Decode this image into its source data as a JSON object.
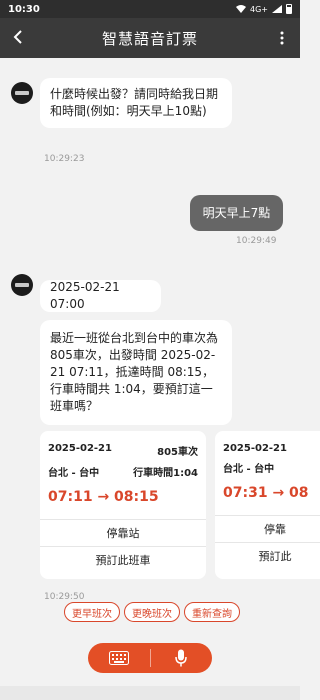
{
  "status": {
    "time": "10:30",
    "network": "4G+"
  },
  "appbar": {
    "back_icon": "arrow-left-icon",
    "title": "智慧語音訂票",
    "more_icon": "more-vert-icon"
  },
  "messages": [
    {
      "from": "bot",
      "text": "什麼時候出發？請同時給我日期和時間(例如：明天早上10點)",
      "time": "10:29:23"
    },
    {
      "from": "user",
      "text": "明天早上7點",
      "time": "10:29:49"
    },
    {
      "from": "bot",
      "text": "2025-02-21 07:00"
    },
    {
      "from": "bot",
      "text": "最近一班從台北到台中的車次為805車次，出發時間 2025-02-21 07:11，抵達時間 08:15，行車時間共 1:04，要預訂這一班車嗎？"
    }
  ],
  "cards": [
    {
      "date": "2025-02-21",
      "train": "805車次",
      "route": "台北 - 台中",
      "duration": "行車時間1:04",
      "times": "07:11 → 08:15",
      "stops": "停靠站",
      "book": "預訂此班車"
    },
    {
      "date": "2025-02-21",
      "route": "台北 - 台中",
      "times": "07:31 → 08",
      "stops": "停靠",
      "book": "預訂此"
    }
  ],
  "cards_time": "10:29:50",
  "quick_replies": [
    "更早班次",
    "更晚班次",
    "重新查詢"
  ],
  "input": {
    "keyboard_icon": "keyboard-icon",
    "mic_icon": "microphone-icon"
  },
  "colors": {
    "accent": "#e34f26",
    "appbar": "#3a3a3a",
    "user_bubble": "#666666"
  }
}
